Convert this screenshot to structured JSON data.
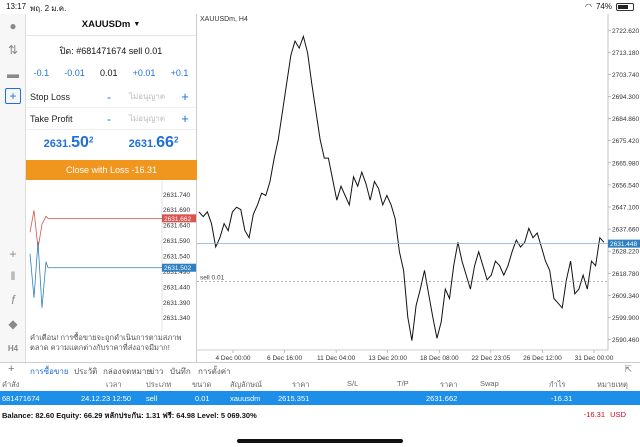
{
  "status": {
    "time": "13:17",
    "date": "พฤ. 2 ม.ค.",
    "battery": "74%",
    "battery_level": 0.74
  },
  "panel": {
    "symbol": "XAUUSDm",
    "ticket": "ปิด: #681471674 sell 0.01",
    "volume": {
      "m2": "-0.1",
      "m1": "-0.01",
      "value": "0.01",
      "p1": "+0.01",
      "p2": "+0.1"
    },
    "stop_loss": {
      "label": "Stop Loss",
      "placeholder": "ไม่อนุญาต"
    },
    "take_profit": {
      "label": "Take Profit",
      "placeholder": "ไม่อนุญาต"
    },
    "bid": {
      "main": "2631.",
      "big": "50",
      "sup": "2"
    },
    "ask": {
      "main": "2631.",
      "big": "66",
      "sup": "2"
    },
    "close_label": "Close with Loss -16.31",
    "warning": "คำเตือน! การซื้อขายจะถูกดำเนินการตามสภาพตลาด ความแตกต่างกับราคาที่ส่งอาจมีมาก!",
    "mini_ticks": [
      "2631.740",
      "2631.690",
      "2631.640",
      "2631.590",
      "2631.540",
      "2631.490",
      "2631.440",
      "2631.390",
      "2631.340"
    ],
    "mini_ask": "2631.662",
    "mini_bid": "2631.502"
  },
  "chart": {
    "title": "XAUUSDm, H4",
    "current_price": "2631.448",
    "order_line_label": "sell 0.01"
  },
  "bottom": {
    "tabs": [
      "การซื้อขาย",
      "ประวัติ",
      "กล่องจดหมาย",
      "ข่าว",
      "บันทึก",
      "การตั้งค่า"
    ],
    "headers": [
      "คำสั่ง",
      "เวลา",
      "ประเภท",
      "ขนาด",
      "สัญลักษณ์",
      "ราคา",
      "S/L",
      "T/P",
      "ราคา",
      "Swap",
      "กำไร",
      "หมายเหตุ"
    ],
    "row": [
      "681471674",
      "24.12.23 12:50",
      "sell",
      "0.01",
      "xauusdm",
      "2615.351",
      "",
      "",
      "2631.662",
      "",
      "-16.31",
      ""
    ],
    "balance_text": "Balance: 82.60 Equity: 66.29 หลักประกัน: 1.31 ฟรี: 64.98 Level: 5 069.30%",
    "total": "-16.31",
    "currency": "USD"
  },
  "chart_data": {
    "type": "line",
    "title": "XAUUSDm, H4",
    "x_ticks": [
      "4 Dec 00:00",
      "6 Dec 16:00",
      "11 Dec 04:00",
      "13 Dec 20:00",
      "18 Dec 08:00",
      "22 Dec 23:05",
      "26 Dec 12:00",
      "31 Dec 00:00"
    ],
    "y_ticks": [
      "2722.620",
      "2713.180",
      "2703.740",
      "2694.300",
      "2684.860",
      "2675.420",
      "2665.980",
      "2656.540",
      "2647.100",
      "2637.660",
      "2628.220",
      "2618.780",
      "2609.340",
      "2599.900",
      "2590.460"
    ],
    "ylim": [
      2586,
      2727
    ],
    "series": [
      {
        "values": [
          2645,
          2643,
          2645,
          2640,
          2630,
          2634,
          2640,
          2637,
          2645,
          2647,
          2646,
          2637,
          2634,
          2644,
          2648,
          2653,
          2652,
          2658,
          2668,
          2676,
          2688,
          2700,
          2712,
          2718,
          2715,
          2720,
          2713,
          2700,
          2688,
          2676,
          2668,
          2668,
          2659,
          2650,
          2656,
          2652,
          2648,
          2660,
          2656,
          2662,
          2657,
          2650,
          2658,
          2655,
          2648,
          2652,
          2648,
          2642,
          2628,
          2620,
          2600,
          2590,
          2605,
          2612,
          2620,
          2610,
          2600,
          2591,
          2598,
          2612,
          2608,
          2622,
          2632,
          2624,
          2618,
          2612,
          2622,
          2628,
          2622,
          2616,
          2618,
          2624,
          2622,
          2618,
          2622,
          2628,
          2633,
          2630,
          2632,
          2638,
          2634,
          2636,
          2630,
          2624,
          2620,
          2608,
          2606,
          2604,
          2616,
          2624,
          2610,
          2612,
          2618,
          2612,
          2624,
          2622,
          2634,
          2632
        ]
      }
    ],
    "mini": {
      "ylim": [
        2631.31,
        2631.77
      ],
      "ask": 2631.662,
      "bid": 2631.502
    }
  }
}
